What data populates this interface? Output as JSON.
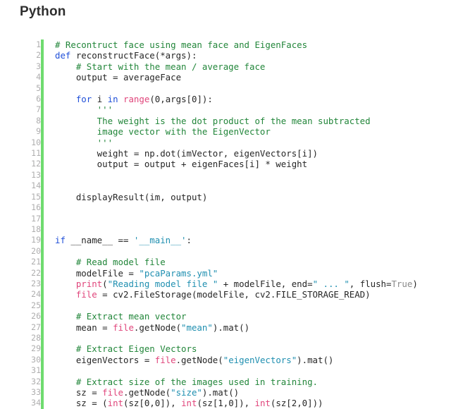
{
  "page": {
    "title": "Python",
    "language": "python",
    "background_color": "#ffffff",
    "gutter_rule_color": "#6fdb6f",
    "line_number_color": "#aeaeae"
  },
  "palette": {
    "plain": "#262626",
    "comment": "#22863a",
    "string": "#1f8fb0",
    "keyword": "#1f4fd8",
    "builtin": "#e0457b",
    "constant": "#8a8a8a"
  },
  "code": {
    "first_line_number": 1,
    "last_line_number": 34,
    "lines": [
      {
        "n": 1,
        "tokens": [
          {
            "t": "# Recontruct face using mean face and EigenFaces",
            "c": "comment"
          }
        ]
      },
      {
        "n": 2,
        "tokens": [
          {
            "t": "def",
            "c": "keyword"
          },
          {
            "t": " reconstructFace(*args):",
            "c": "plain"
          }
        ]
      },
      {
        "n": 3,
        "tokens": [
          {
            "t": "    # Start with the mean / average face",
            "c": "comment"
          }
        ]
      },
      {
        "n": 4,
        "tokens": [
          {
            "t": "    output = averageFace",
            "c": "plain"
          }
        ]
      },
      {
        "n": 5,
        "tokens": [
          {
            "t": "",
            "c": "plain"
          }
        ]
      },
      {
        "n": 6,
        "tokens": [
          {
            "t": "    ",
            "c": "plain"
          },
          {
            "t": "for",
            "c": "keyword"
          },
          {
            "t": " i ",
            "c": "plain"
          },
          {
            "t": "in",
            "c": "keyword"
          },
          {
            "t": " ",
            "c": "plain"
          },
          {
            "t": "range",
            "c": "builtin"
          },
          {
            "t": "(0,args[0]):",
            "c": "plain"
          }
        ]
      },
      {
        "n": 7,
        "tokens": [
          {
            "t": "        '''",
            "c": "doc"
          }
        ]
      },
      {
        "n": 8,
        "tokens": [
          {
            "t": "        The weight is the dot product of the mean subtracted",
            "c": "doc"
          }
        ]
      },
      {
        "n": 9,
        "tokens": [
          {
            "t": "        image vector with the EigenVector",
            "c": "doc"
          }
        ]
      },
      {
        "n": 10,
        "tokens": [
          {
            "t": "        '''",
            "c": "doc"
          }
        ]
      },
      {
        "n": 11,
        "tokens": [
          {
            "t": "        weight = np.dot(imVector, eigenVectors[i])",
            "c": "plain"
          }
        ]
      },
      {
        "n": 12,
        "tokens": [
          {
            "t": "        output = output + eigenFaces[i] * weight",
            "c": "plain"
          }
        ]
      },
      {
        "n": 13,
        "tokens": [
          {
            "t": "",
            "c": "plain"
          }
        ]
      },
      {
        "n": 14,
        "tokens": [
          {
            "t": "",
            "c": "plain"
          }
        ]
      },
      {
        "n": 15,
        "tokens": [
          {
            "t": "    displayResult(im, output)",
            "c": "plain"
          }
        ]
      },
      {
        "n": 16,
        "tokens": [
          {
            "t": "",
            "c": "plain"
          }
        ]
      },
      {
        "n": 17,
        "tokens": [
          {
            "t": "",
            "c": "plain"
          }
        ]
      },
      {
        "n": 18,
        "tokens": [
          {
            "t": "",
            "c": "plain"
          }
        ]
      },
      {
        "n": 19,
        "tokens": [
          {
            "t": "if",
            "c": "keyword"
          },
          {
            "t": " __name__ == ",
            "c": "plain"
          },
          {
            "t": "'__main__'",
            "c": "string"
          },
          {
            "t": ":",
            "c": "plain"
          }
        ]
      },
      {
        "n": 20,
        "tokens": [
          {
            "t": "",
            "c": "plain"
          }
        ]
      },
      {
        "n": 21,
        "tokens": [
          {
            "t": "    # Read model file",
            "c": "comment"
          }
        ]
      },
      {
        "n": 22,
        "tokens": [
          {
            "t": "    modelFile = ",
            "c": "plain"
          },
          {
            "t": "\"pcaParams.yml\"",
            "c": "string"
          }
        ]
      },
      {
        "n": 23,
        "tokens": [
          {
            "t": "    ",
            "c": "plain"
          },
          {
            "t": "print",
            "c": "builtin"
          },
          {
            "t": "(",
            "c": "plain"
          },
          {
            "t": "\"Reading model file \"",
            "c": "string"
          },
          {
            "t": " + modelFile, end=",
            "c": "plain"
          },
          {
            "t": "\" ... \"",
            "c": "string"
          },
          {
            "t": ", flush=",
            "c": "plain"
          },
          {
            "t": "True",
            "c": "const"
          },
          {
            "t": ")",
            "c": "plain"
          }
        ]
      },
      {
        "n": 24,
        "tokens": [
          {
            "t": "    ",
            "c": "plain"
          },
          {
            "t": "file",
            "c": "builtin"
          },
          {
            "t": " = cv2.FileStorage(modelFile, cv2.FILE_STORAGE_READ)",
            "c": "plain"
          }
        ]
      },
      {
        "n": 25,
        "tokens": [
          {
            "t": "",
            "c": "plain"
          }
        ]
      },
      {
        "n": 26,
        "tokens": [
          {
            "t": "    # Extract mean vector",
            "c": "comment"
          }
        ]
      },
      {
        "n": 27,
        "tokens": [
          {
            "t": "    mean = ",
            "c": "plain"
          },
          {
            "t": "file",
            "c": "builtin"
          },
          {
            "t": ".getNode(",
            "c": "plain"
          },
          {
            "t": "\"mean\"",
            "c": "string"
          },
          {
            "t": ").mat()",
            "c": "plain"
          }
        ]
      },
      {
        "n": 28,
        "tokens": [
          {
            "t": "",
            "c": "plain"
          }
        ]
      },
      {
        "n": 29,
        "tokens": [
          {
            "t": "    # Extract Eigen Vectors",
            "c": "comment"
          }
        ]
      },
      {
        "n": 30,
        "tokens": [
          {
            "t": "    eigenVectors = ",
            "c": "plain"
          },
          {
            "t": "file",
            "c": "builtin"
          },
          {
            "t": ".getNode(",
            "c": "plain"
          },
          {
            "t": "\"eigenVectors\"",
            "c": "string"
          },
          {
            "t": ").mat()",
            "c": "plain"
          }
        ]
      },
      {
        "n": 31,
        "tokens": [
          {
            "t": "",
            "c": "plain"
          }
        ]
      },
      {
        "n": 32,
        "tokens": [
          {
            "t": "    # Extract size of the images used in training.",
            "c": "comment"
          }
        ]
      },
      {
        "n": 33,
        "tokens": [
          {
            "t": "    sz = ",
            "c": "plain"
          },
          {
            "t": "file",
            "c": "builtin"
          },
          {
            "t": ".getNode(",
            "c": "plain"
          },
          {
            "t": "\"size\"",
            "c": "string"
          },
          {
            "t": ").mat()",
            "c": "plain"
          }
        ]
      },
      {
        "n": 34,
        "tokens": [
          {
            "t": "    sz = (",
            "c": "plain"
          },
          {
            "t": "int",
            "c": "builtin"
          },
          {
            "t": "(sz[0,0]), ",
            "c": "plain"
          },
          {
            "t": "int",
            "c": "builtin"
          },
          {
            "t": "(sz[1,0]), ",
            "c": "plain"
          },
          {
            "t": "int",
            "c": "builtin"
          },
          {
            "t": "(sz[2,0]))",
            "c": "plain"
          }
        ]
      }
    ]
  }
}
